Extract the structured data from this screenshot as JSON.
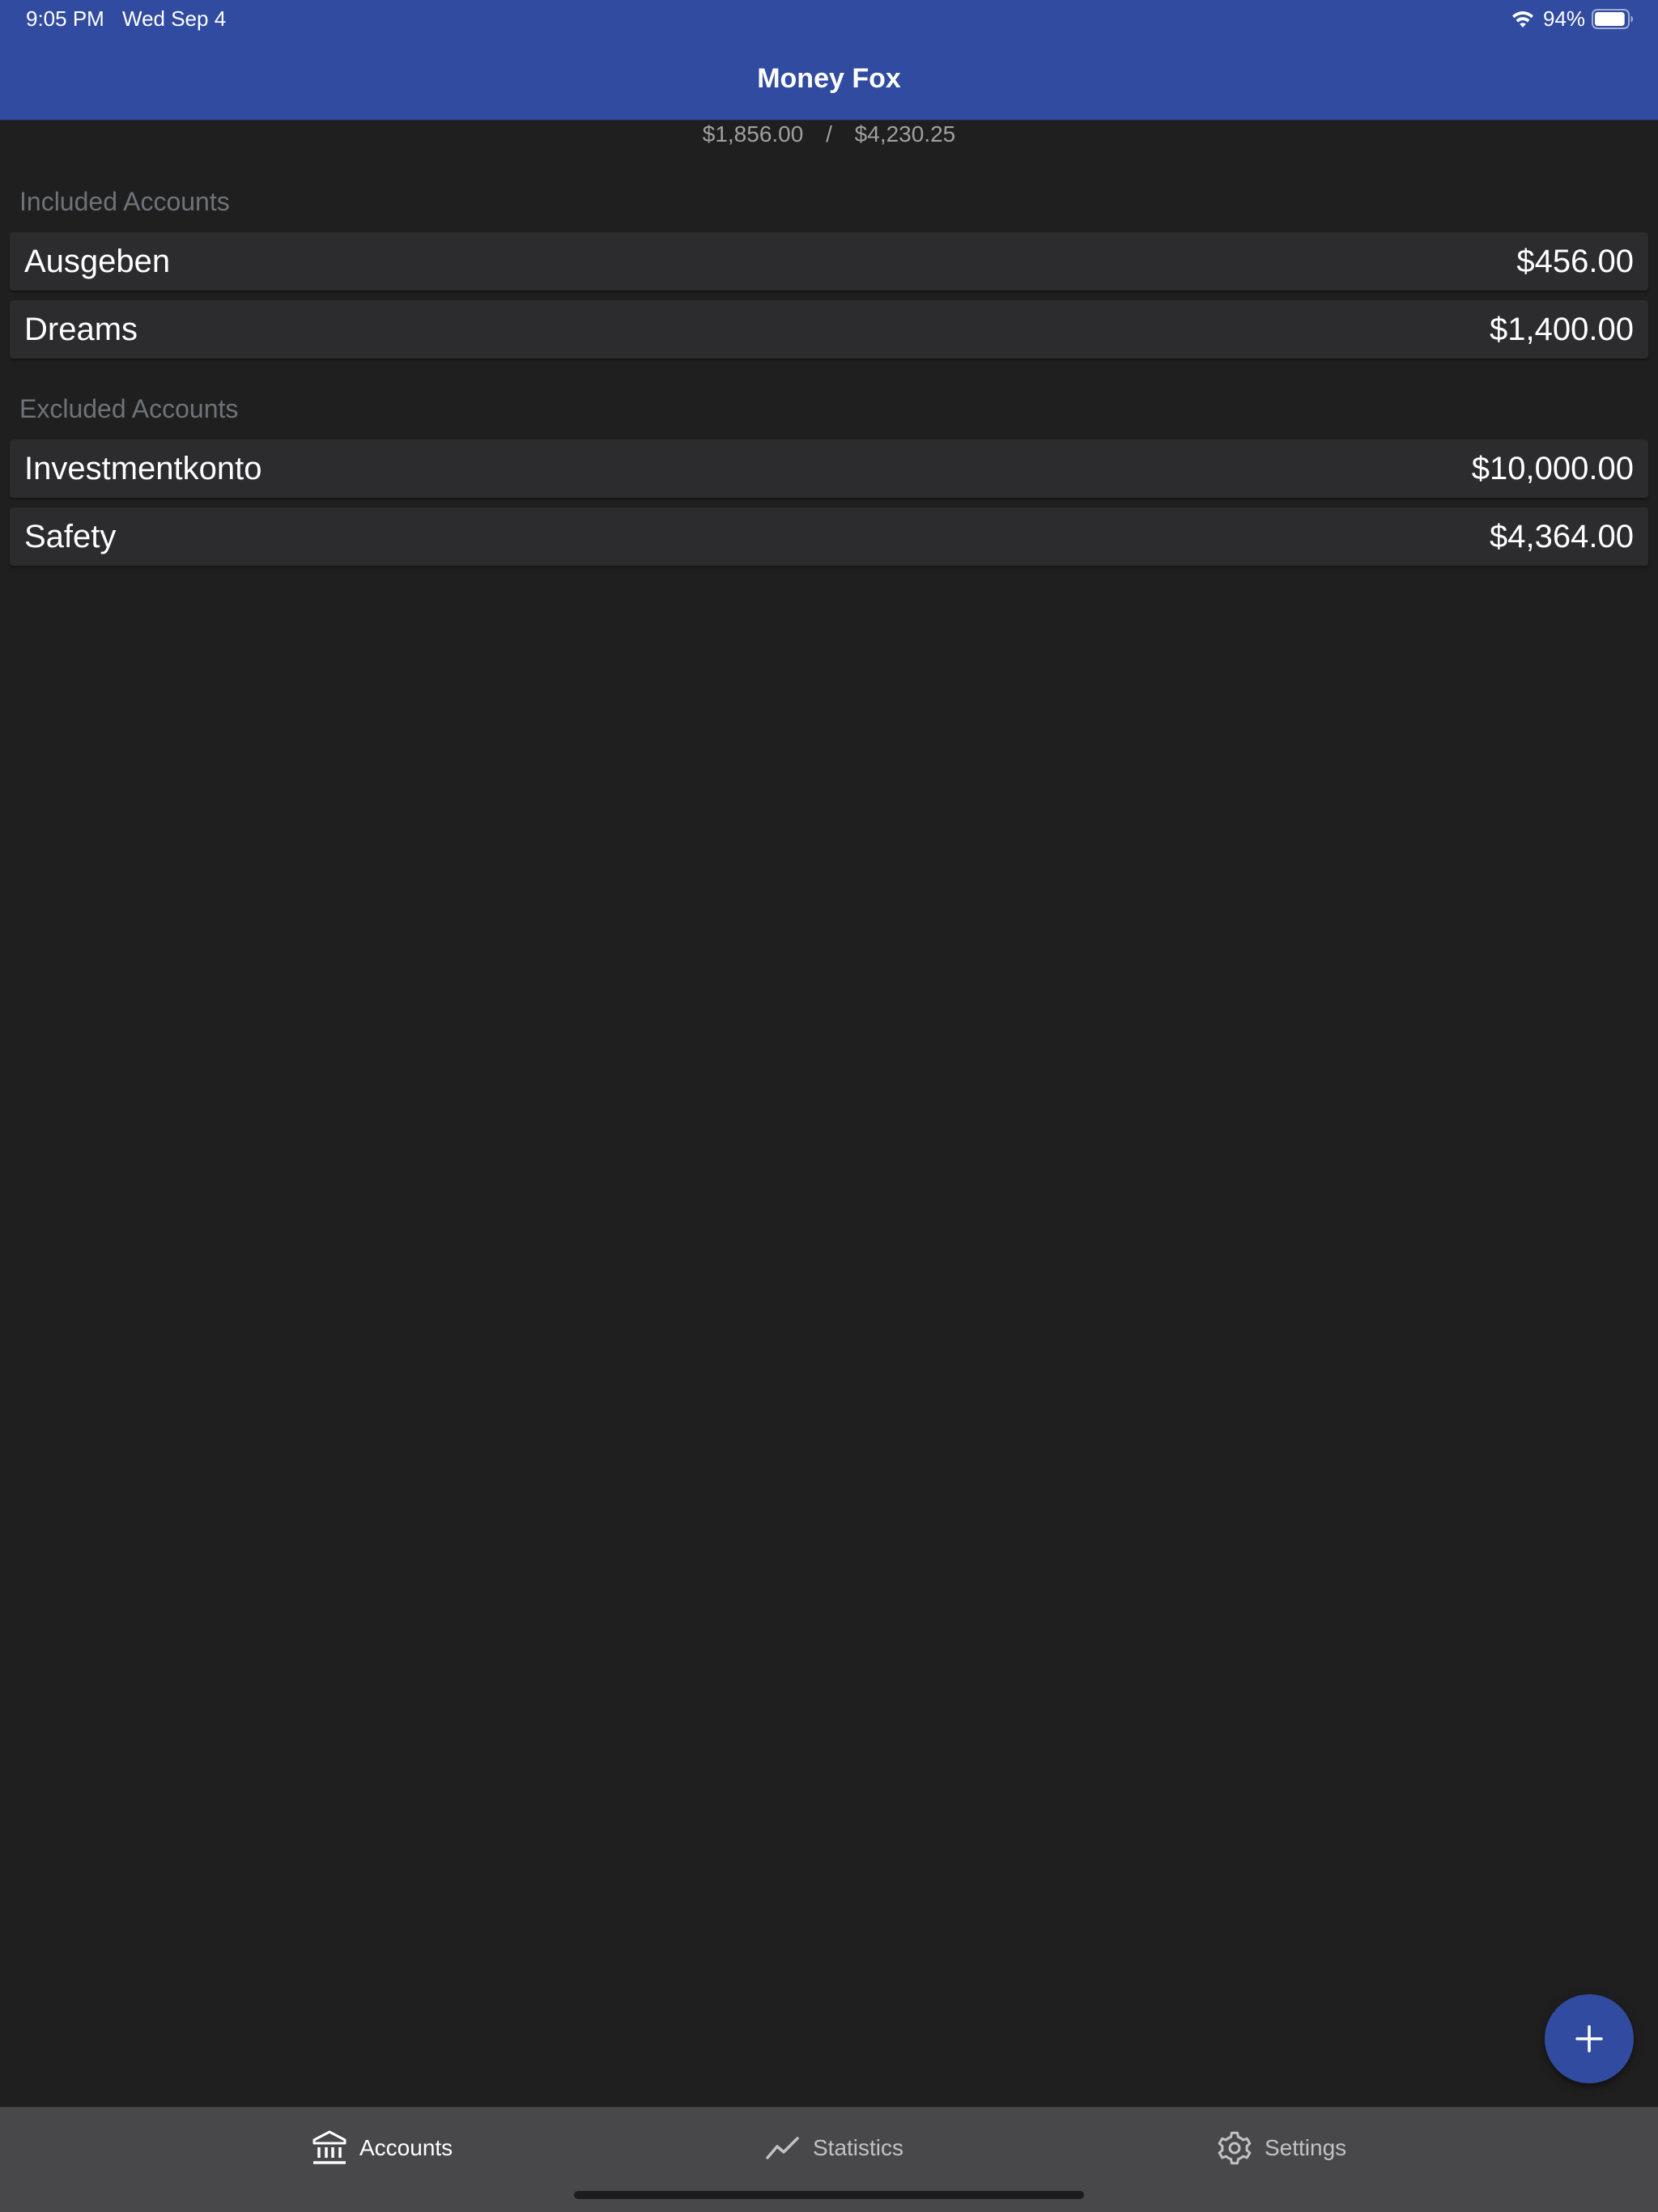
{
  "status_bar": {
    "time": "9:05 PM",
    "date": "Wed Sep 4",
    "battery_percent": "94%",
    "battery_level": 0.94,
    "icons": [
      "wifi-icon",
      "battery-icon"
    ]
  },
  "header": {
    "title": "Money Fox",
    "background_color": "#304ba0"
  },
  "balance": {
    "current": "$1,856.00",
    "separator": "/",
    "end_of_month": "$4,230.25"
  },
  "included_section": {
    "title": "Included Accounts",
    "accounts": [
      {
        "name": "Ausgeben",
        "amount": "$456.00"
      },
      {
        "name": "Dreams",
        "amount": "$1,400.00"
      }
    ]
  },
  "excluded_section": {
    "title": "Excluded Accounts",
    "accounts": [
      {
        "name": "Investmentkonto",
        "amount": "$10,000.00"
      },
      {
        "name": "Safety",
        "amount": "$4,364.00"
      }
    ]
  },
  "fab": {
    "icon": "plus-icon"
  },
  "tabbar": {
    "tabs": [
      {
        "label": "Accounts",
        "icon": "bank-icon",
        "selected": true
      },
      {
        "label": "Statistics",
        "icon": "chart-line-icon",
        "selected": false
      },
      {
        "label": "Settings",
        "icon": "gear-icon",
        "selected": false
      }
    ]
  }
}
